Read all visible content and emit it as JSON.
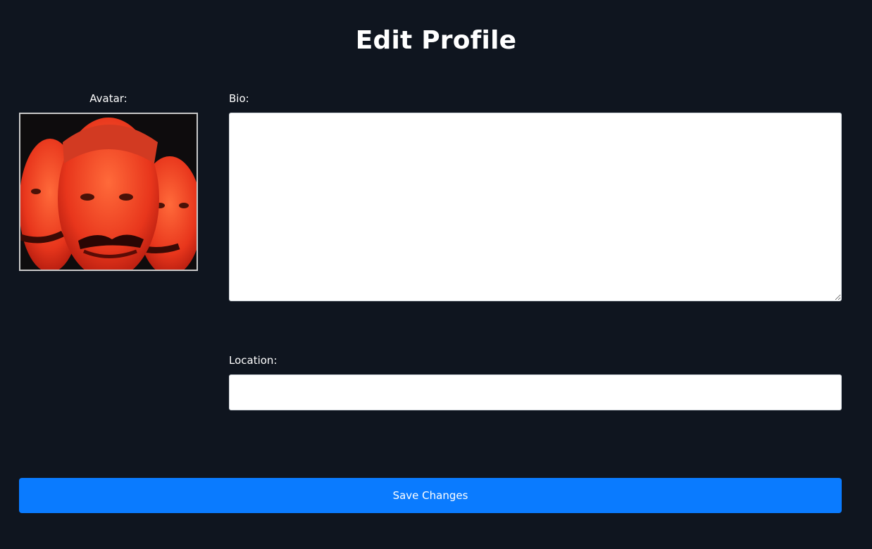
{
  "header": {
    "title": "Edit Profile"
  },
  "avatar": {
    "label": "Avatar:"
  },
  "bio": {
    "label": "Bio:",
    "value": ""
  },
  "location": {
    "label": "Location:",
    "value": ""
  },
  "actions": {
    "save_label": "Save Changes"
  },
  "colors": {
    "background": "#0f151f",
    "primary_button": "#0a7bff",
    "text": "#ffffff",
    "input_background": "#ffffff"
  }
}
